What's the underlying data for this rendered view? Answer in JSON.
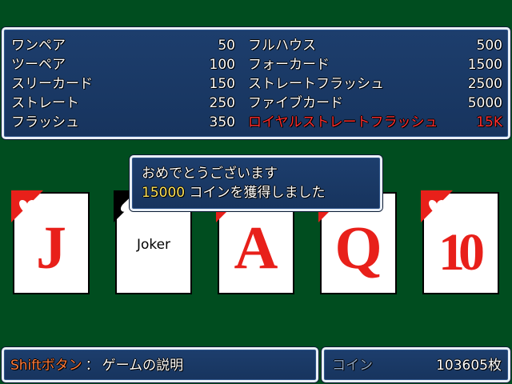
{
  "paytable": {
    "left": [
      {
        "name": "ワンペア",
        "value": "50"
      },
      {
        "name": "ツーペア",
        "value": "100"
      },
      {
        "name": "スリーカード",
        "value": "150"
      },
      {
        "name": "ストレート",
        "value": "250"
      },
      {
        "name": "フラッシュ",
        "value": "350"
      }
    ],
    "right": [
      {
        "name": "フルハウス",
        "value": "500"
      },
      {
        "name": "フォーカード",
        "value": "1500"
      },
      {
        "name": "ストレートフラッシュ",
        "value": "2500"
      },
      {
        "name": "ファイブカード",
        "value": "5000"
      },
      {
        "name": "ロイヤルストレートフラッシュ",
        "value": "15K"
      }
    ]
  },
  "message": {
    "line1": "おめでとうございます",
    "amount": "15000",
    "line2_suffix": " コインを獲得しました"
  },
  "cards": [
    {
      "rank": "J",
      "suit": "heart"
    },
    {
      "rank": "",
      "suit": "spade",
      "label": "Joker"
    },
    {
      "rank": "A",
      "suit": "heart"
    },
    {
      "rank": "Q",
      "suit": "heart"
    },
    {
      "rank": "10",
      "suit": "heart"
    }
  ],
  "help": {
    "key": "Shiftボタン",
    "separator": "：",
    "text": "ゲームの説明"
  },
  "coins": {
    "label": "コイン",
    "value": "103605",
    "unit": "枚"
  },
  "colors": {
    "table_green": "#004d1f",
    "window_blue": "#1d3e6d",
    "highlight_red": "#ff2e2e",
    "amount_yellow": "#ffe35a",
    "key_orange": "#ff7a3a"
  }
}
